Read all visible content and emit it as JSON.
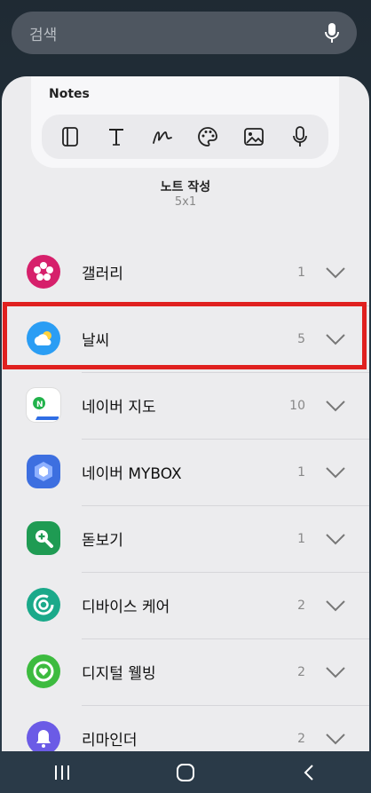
{
  "search": {
    "placeholder": "검색"
  },
  "widget": {
    "title": "Notes",
    "tools": [
      "notebook-icon",
      "text-icon",
      "pen-icon",
      "palette-icon",
      "image-icon",
      "mic-icon"
    ],
    "name": "노트 작성",
    "size": "5x1"
  },
  "apps": [
    {
      "name": "갤러리",
      "count": "1",
      "icon": "gallery-icon",
      "color": "#d6206b"
    },
    {
      "name": "날씨",
      "count": "5",
      "icon": "weather-icon",
      "color": "#2a9df4"
    },
    {
      "name": "네이버 지도",
      "count": "10",
      "icon": "naver-map-icon",
      "color": "#ffffff"
    },
    {
      "name": "네이버 MYBOX",
      "count": "1",
      "icon": "naver-mybox-icon",
      "color": "#3d6fe0"
    },
    {
      "name": "돋보기",
      "count": "1",
      "icon": "magnifier-icon",
      "color": "#1f9b53"
    },
    {
      "name": "디바이스 케어",
      "count": "2",
      "icon": "device-care-icon",
      "color": "#1aa98a"
    },
    {
      "name": "디지털 웰빙",
      "count": "2",
      "icon": "digital-wellbeing-icon",
      "color": "#3dbb3f"
    },
    {
      "name": "리마인더",
      "count": "2",
      "icon": "reminder-icon",
      "color": "#6b5be6"
    }
  ],
  "highlight_color": "#e0201f"
}
